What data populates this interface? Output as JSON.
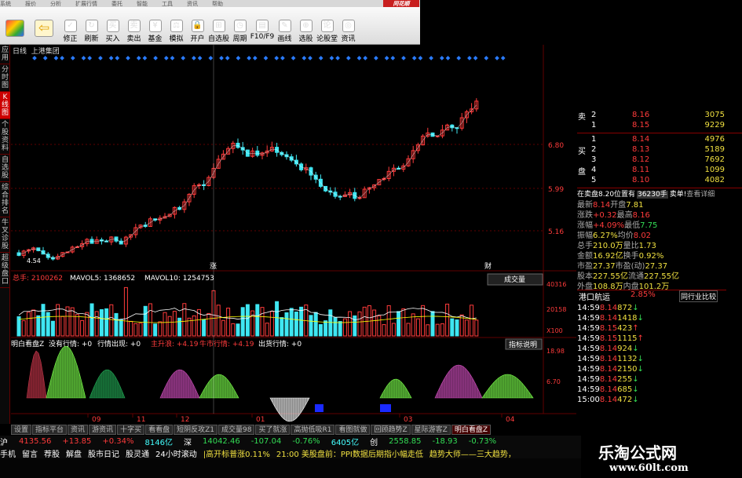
{
  "menu": {
    "items": [
      "系统",
      "报价",
      "分析",
      "扩展行情",
      "委托",
      "智能",
      "工具",
      "资讯",
      "帮助"
    ],
    "logo": "同花顺"
  },
  "toolbar": {
    "buttons": [
      "修正",
      "刷新",
      "买入",
      "卖出",
      "基金",
      "模拟",
      "开户",
      "自选股",
      "周期",
      "F10/F9",
      "画线",
      "选股",
      "论股堂",
      "资讯"
    ]
  },
  "sidebar": {
    "items": [
      "应用",
      "分时图",
      "K线图",
      "个股资料",
      "自选股",
      "综合排名",
      "牛叉诊股",
      "超级盘口"
    ],
    "active": 2
  },
  "chart": {
    "period_label": "日线",
    "stock_name": "上港集团",
    "price_labels": [
      "6.80",
      "5.99",
      "5.16"
    ],
    "low_label": "4.54",
    "vol_labels": [
      "40316",
      "20158",
      "X100"
    ],
    "date_labels": [
      "09",
      "11",
      "12",
      "01",
      "03",
      "04"
    ],
    "ind_labels": [
      "18.98",
      "6.70"
    ],
    "rise_marker": "涨",
    "fin_marker": "财"
  },
  "volume": {
    "total_label": "总手: 2100262",
    "ma5": "MAVOL5: 1368652",
    "ma10": "MAVOL10: 1254753",
    "button": "成交量"
  },
  "indicator": {
    "name": "明白看盘Z",
    "items": [
      "没有行情: +0",
      "行情出现: +0",
      "主升浪: +4.19",
      "牛市行情: +4.19",
      "出货行情: +0"
    ],
    "button": "指标说明"
  },
  "orderbook": {
    "sell_label": "卖",
    "buy_label1": "买",
    "buy_label2": "盘",
    "sells": [
      [
        "2",
        "8.16",
        "3075"
      ],
      [
        "1",
        "8.15",
        "9229"
      ]
    ],
    "buys": [
      [
        "1",
        "8.14",
        "4976"
      ],
      [
        "2",
        "8.13",
        "5189"
      ],
      [
        "3",
        "8.12",
        "7692"
      ],
      [
        "4",
        "8.11",
        "1099"
      ],
      [
        "5",
        "8.10",
        "4082"
      ]
    ]
  },
  "info_line": "在卖盘8.20位置有",
  "info_vol": "36230手",
  "info_action": "卖单!",
  "info_link": "查看详细",
  "stats": [
    [
      "最新",
      "8.14",
      "开盘",
      "7.81"
    ],
    [
      "涨跌",
      "+0.32",
      "最高",
      "8.16"
    ],
    [
      "涨幅",
      "+4.09%",
      "最低",
      "7.75"
    ],
    [
      "振幅",
      "6.27%",
      "均价",
      "8.02"
    ],
    [
      "总手",
      "210.0万",
      "量比",
      "1.73"
    ],
    [
      "金额",
      "16.92亿",
      "换手",
      "0.92%"
    ],
    [
      "市盈",
      "27.37",
      "市盈(动)",
      "27.37"
    ],
    [
      "股本",
      "227.55亿",
      "流通",
      "227.55亿"
    ],
    [
      "外盘",
      "108.8万",
      "内盘",
      "101.2万"
    ]
  ],
  "industry": {
    "name": "港口航运",
    "pct": "2.85%",
    "button": "同行业比较"
  },
  "ticks": [
    [
      "14:59",
      "8.14",
      "872"
    ],
    [
      "14:59",
      "8.14",
      "1418"
    ],
    [
      "14:59",
      "8.15",
      "423"
    ],
    [
      "14:59",
      "8.15",
      "1115"
    ],
    [
      "14:59",
      "8.14",
      "924"
    ],
    [
      "14:59",
      "8.14",
      "1132"
    ],
    [
      "14:59",
      "8.14",
      "2150"
    ],
    [
      "14:59",
      "8.14",
      "255"
    ],
    [
      "14:59",
      "8.14",
      "685"
    ],
    [
      "15:00",
      "8.14",
      "472"
    ]
  ],
  "bottom_tabs": [
    "设置",
    "指标平台",
    "资讯",
    "游资讯",
    "十字买",
    "看看盘",
    "短阴反攻Z1",
    "成交量98",
    "买了就涨",
    "高抛低吸R1",
    "看图就做",
    "回顾趋势Z",
    "星际游客Z",
    "明白看盘Z"
  ],
  "index_bar": {
    "sh": "沪",
    "sh_val": "4135.56",
    "sh_chg": "+13.85",
    "sh_pct": "+0.34%",
    "sh_amt": "8146亿",
    "sz": "深",
    "sz_val": "14042.46",
    "sz_chg": "-107.04",
    "sz_pct": "-0.76%",
    "cy_amt": "6405亿",
    "cy": "创",
    "cy_val": "2558.85",
    "cy_chg": "-18.93",
    "cy_pct": "-0.73%"
  },
  "status_bar": [
    "手机",
    "留言",
    "荐股",
    "解盘",
    "股市日记",
    "股灵通",
    "24小时滚动",
    "|高开标普涨0.11%",
    "21:00 美股盘前：PPI数据后期指小幅走低",
    "趋势大师——三大趋势，"
  ],
  "watermark": {
    "title": "乐淘公式网",
    "url": "www.60lt.com"
  },
  "colors": {
    "up": "#ff3b3b",
    "down": "#3fe6f2",
    "grid": "#600000",
    "accent": "#c00000"
  }
}
